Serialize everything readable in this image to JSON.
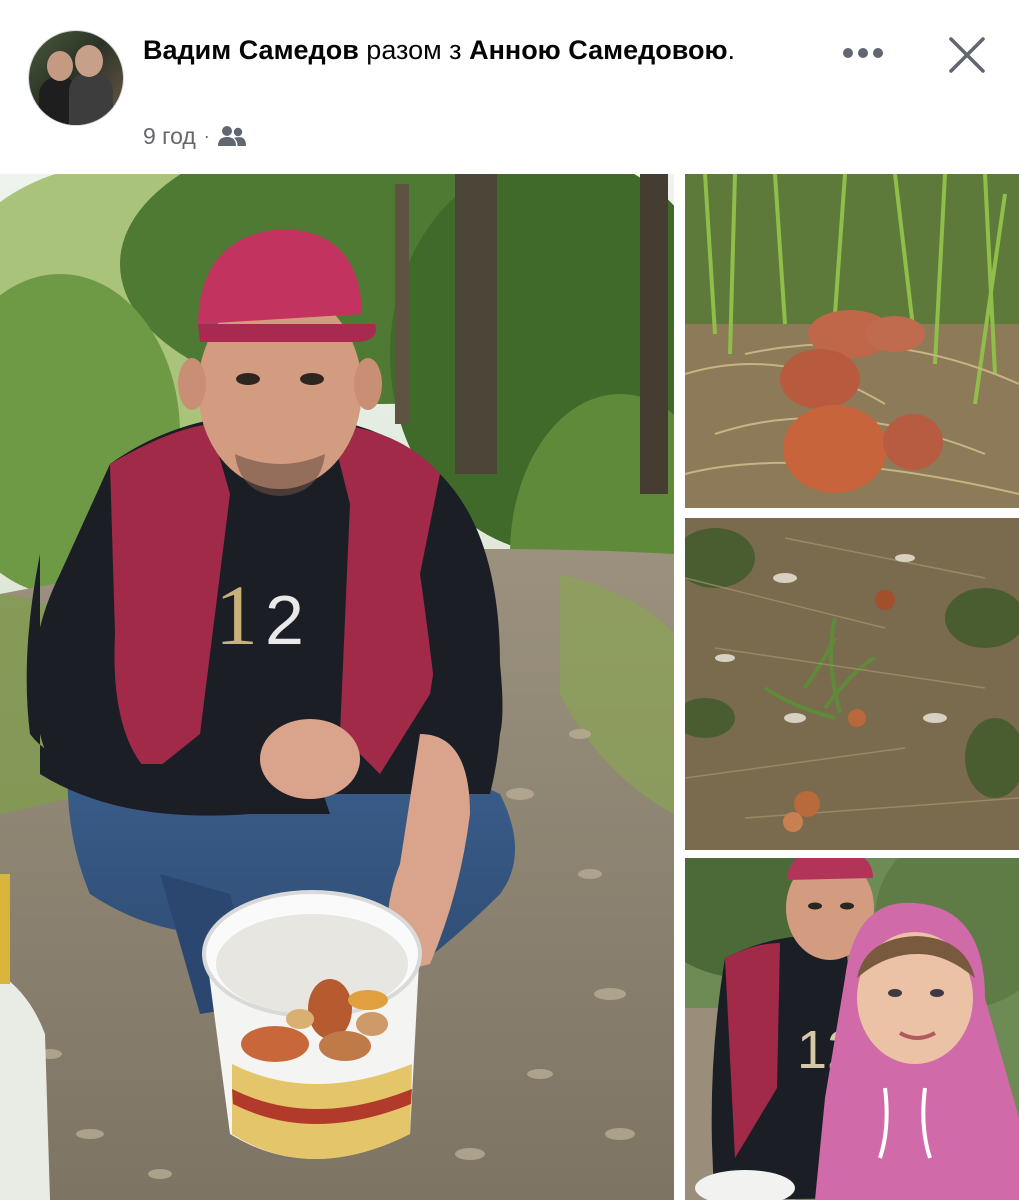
{
  "post": {
    "author": "Вадим Самедов",
    "connector": " разом з ",
    "tagged": "Анною Самедовою",
    "period": ".",
    "time": "9 год",
    "separator": "·",
    "audience_icon": "friends-icon"
  },
  "actions": {
    "more_icon": "more-horizontal-icon",
    "close_icon": "close-icon"
  },
  "photos": [
    {
      "id": "photo-main",
      "subject": "man-with-mushroom-bucket-photo"
    },
    {
      "id": "photo-a",
      "subject": "mushrooms-in-grass-photo"
    },
    {
      "id": "photo-b",
      "subject": "forest-floor-mushrooms-photo"
    },
    {
      "id": "photo-c",
      "subject": "couple-selfie-photo"
    }
  ],
  "colors": {
    "text_primary": "#050505",
    "text_secondary": "#65676b",
    "icon": "#606770"
  },
  "cap_print": {
    "left_digit": "1",
    "right_digit": "2",
    "shirt_text": "12"
  }
}
